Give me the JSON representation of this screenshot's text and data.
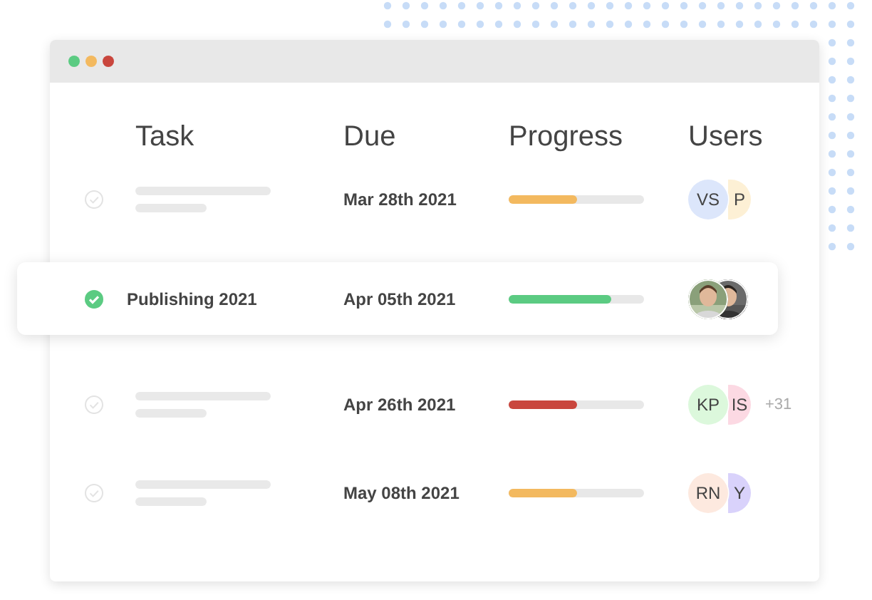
{
  "columns": [
    "Task",
    "Due",
    "Progress",
    "Users"
  ],
  "rows": [
    {
      "kind": "placeholder",
      "checked": false,
      "highlighted": false,
      "due": "Mar 28th 2021",
      "progress": {
        "level": 0.5,
        "color": "#f3b95f"
      },
      "users": [
        {
          "kind": "initials",
          "initials": "VS",
          "color": "#dce6fb"
        },
        {
          "kind": "initials",
          "initials": "P",
          "color": "#fdf0d5"
        }
      ]
    },
    {
      "kind": "named",
      "task": "Publishing 2021",
      "checked": true,
      "highlighted": true,
      "due": "Apr 05th 2021",
      "progress": {
        "level": 0.76,
        "color": "#5bcb82"
      }
    },
    {
      "kind": "placeholder",
      "checked": false,
      "highlighted": false,
      "due": "Apr 26th 2021",
      "progress": {
        "level": 0.5,
        "color": "#c9463d"
      },
      "users": [
        {
          "kind": "initials",
          "initials": "KP",
          "color": "#dcf8dc"
        },
        {
          "kind": "initials",
          "initials": "IS",
          "color": "#fcd9e3"
        }
      ],
      "extra": "+31"
    },
    {
      "kind": "placeholder",
      "checked": false,
      "highlighted": false,
      "due": "May 08th 2021",
      "progress": {
        "level": 0.5,
        "color": "#f3b95f"
      },
      "users": [
        {
          "kind": "initials",
          "initials": "RN",
          "color": "#fde9df"
        },
        {
          "kind": "initials",
          "initials": "Y",
          "color": "#d9d2fb"
        }
      ]
    }
  ]
}
